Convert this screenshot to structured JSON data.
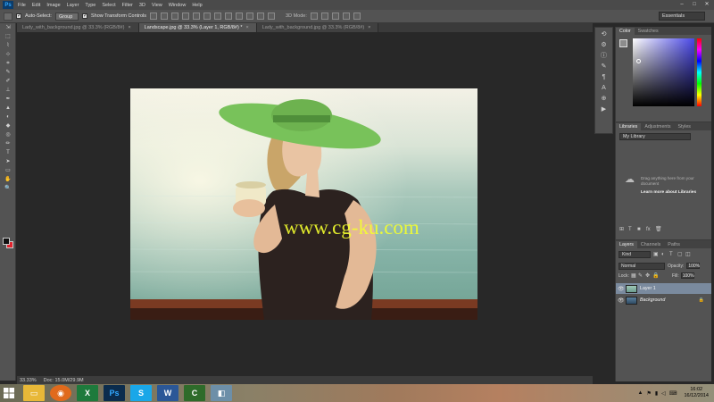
{
  "menubar": {
    "logo": "Ps",
    "items": [
      "File",
      "Edit",
      "Image",
      "Layer",
      "Type",
      "Select",
      "Filter",
      "3D",
      "View",
      "Window",
      "Help"
    ],
    "window_buttons": [
      "–",
      "□",
      "✕"
    ]
  },
  "options": {
    "auto_select_label": "Auto-Select:",
    "auto_select_value": "Group",
    "show_transform_label": "Show Transform Controls",
    "mode_3d_label": "3D Mode:",
    "workspace": "Essentials"
  },
  "tabs": [
    {
      "label": "Lady_with_background.jpg @ 33.3% (RGB/8#)",
      "active": false
    },
    {
      "label": "Landscape.jpg @ 33.3% (Layer 1, RGB/8#) *",
      "active": true
    },
    {
      "label": "Lady_with_background.jpg @ 33.3% (RGB/8#)",
      "active": false
    }
  ],
  "tab_close_glyph": "×",
  "tools": [
    "⇲",
    "⬚",
    "⌇",
    "⊹",
    "⌗",
    "✎",
    "✐",
    "⊥",
    "✒",
    "▲",
    "◐",
    "◆",
    "◎",
    "✏",
    "T",
    "➤",
    "▭",
    "✋",
    "🔍"
  ],
  "canvas": {
    "watermark": "www.cg-ku.com"
  },
  "status": {
    "zoom": "33.33%",
    "doc": "Doc: 15.0M/29.9M"
  },
  "color_panel": {
    "tabs": [
      "Color",
      "Swatches"
    ],
    "foreground": "#8c8c8c",
    "background": "#d23c52"
  },
  "libraries_panel": {
    "tabs": [
      "Libraries",
      "Adjustments",
      "Styles"
    ],
    "selected_library": "My Library",
    "message": "Drag anything here from your document",
    "link": "Learn more about Libraries"
  },
  "layers_panel": {
    "tabs": [
      "Layers",
      "Channels",
      "Paths"
    ],
    "kind": "Kind",
    "blend_mode": "Normal",
    "opacity_label": "Opacity:",
    "opacity": "100%",
    "lock_label": "Lock:",
    "fill_label": "Fill:",
    "fill": "100%",
    "layers": [
      {
        "name": "Layer 1",
        "selected": true
      },
      {
        "name": "Background",
        "selected": false
      }
    ]
  },
  "taskbar": {
    "apps": [
      {
        "icon": "file-explorer-icon",
        "color": "#e8b838"
      },
      {
        "icon": "firefox-icon",
        "color": "#e06a1c"
      },
      {
        "icon": "excel-icon",
        "color": "#1e7a3c"
      },
      {
        "icon": "photoshop-icon",
        "color": "#0b2c4d"
      },
      {
        "icon": "skype-icon",
        "color": "#1aa7e8"
      },
      {
        "icon": "word-icon",
        "color": "#2b5797"
      },
      {
        "icon": "camtasia-icon",
        "color": "#2e6b2a"
      },
      {
        "icon": "generic-app-icon",
        "color": "#6d8fa8"
      }
    ],
    "time": "16:02",
    "date": "16/12/2014"
  }
}
